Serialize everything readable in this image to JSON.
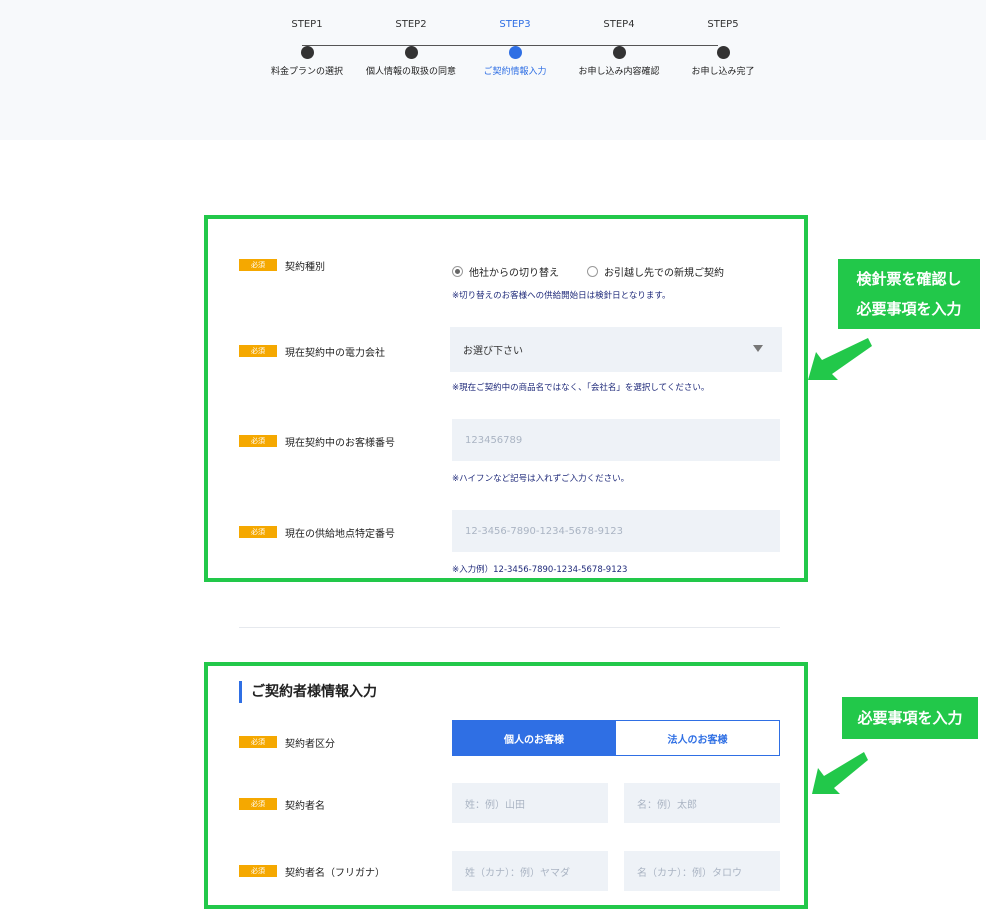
{
  "steps": [
    {
      "num": "STEP1",
      "name": "料金プランの選択"
    },
    {
      "num": "STEP2",
      "name": "個人情報の取扱の同意"
    },
    {
      "num": "STEP3",
      "name": "ご契約情報入力"
    },
    {
      "num": "STEP4",
      "name": "お申し込み内容確認"
    },
    {
      "num": "STEP5",
      "name": "お申し込み完了"
    }
  ],
  "required_badge": "必須",
  "contract": {
    "type_label": "契約種別",
    "radio1": "他社からの切り替え",
    "radio2": "お引越し先での新規ご契約",
    "type_note": "※切り替えのお客様への供給開始日は検針日となります。",
    "company_label": "現在契約中の電力会社",
    "company_select": "お選び下さい",
    "company_note": "※現在ご契約中の商品名ではなく、「会社名」を選択してください。",
    "customer_no_label": "現在契約中のお客様番号",
    "customer_no_placeholder": "123456789",
    "customer_no_note": "※ハイフンなど記号は入れずご入力ください。",
    "supply_point_label": "現在の供給地点特定番号",
    "supply_point_placeholder": "12-3456-7890-1234-5678-9123",
    "supply_point_note": "※入力例）12-3456-7890-1234-5678-9123"
  },
  "contractor": {
    "section_title": "ご契約者様情報入力",
    "type_label": "契約者区分",
    "individual": "個人のお客様",
    "corporate": "法人のお客様",
    "name_label": "契約者名",
    "last_name_placeholder": "姓：例）山田",
    "first_name_placeholder": "名：例）太郎",
    "kana_label": "契約者名（フリガナ）",
    "last_kana_placeholder": "姓（カナ）：例）ヤマダ",
    "first_kana_placeholder": "名（カナ）：例）タロウ"
  },
  "callouts": {
    "c1_line1": "検針票を確認し",
    "c1_line2": "必要事項を入力",
    "c2": "必要事項を入力"
  },
  "colors": {
    "accent": "#2f6fe4",
    "badge": "#f5a800",
    "highlight": "#22c84a"
  }
}
